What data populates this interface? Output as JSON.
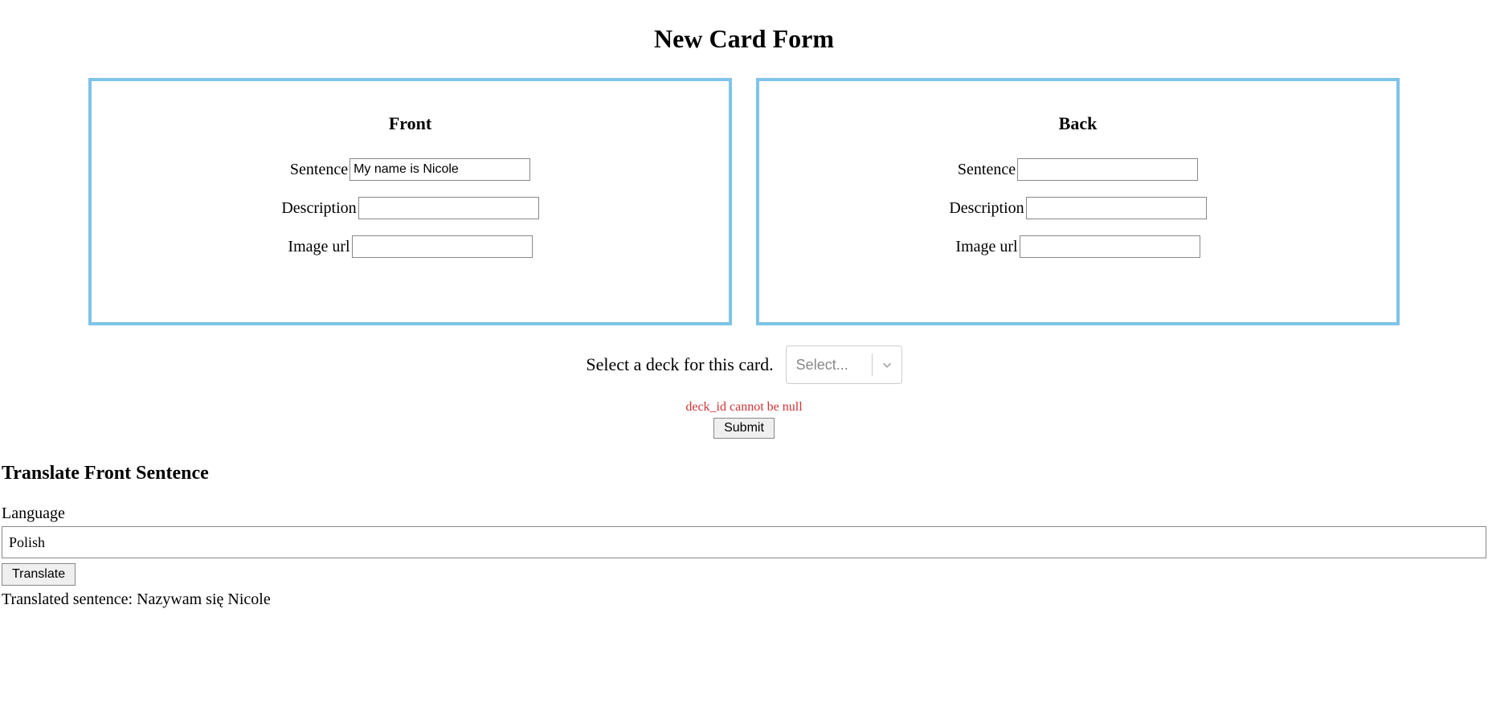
{
  "page_title": "New Card Form",
  "front": {
    "title": "Front",
    "sentence_label": "Sentence",
    "sentence_value": "My name is Nicole",
    "description_label": "Description",
    "description_value": "",
    "image_url_label": "Image url",
    "image_url_value": ""
  },
  "back": {
    "title": "Back",
    "sentence_label": "Sentence",
    "sentence_value": "",
    "description_label": "Description",
    "description_value": "",
    "image_url_label": "Image url",
    "image_url_value": ""
  },
  "deck_select": {
    "label": "Select a deck for this card.",
    "placeholder": "Select..."
  },
  "error_message": "deck_id cannot be null",
  "submit_label": "Submit",
  "translate": {
    "heading": "Translate Front Sentence",
    "language_label": "Language",
    "language_value": "Polish",
    "button_label": "Translate",
    "result_prefix": "Translated sentence: ",
    "result_value": "Nazywam się Nicole"
  }
}
